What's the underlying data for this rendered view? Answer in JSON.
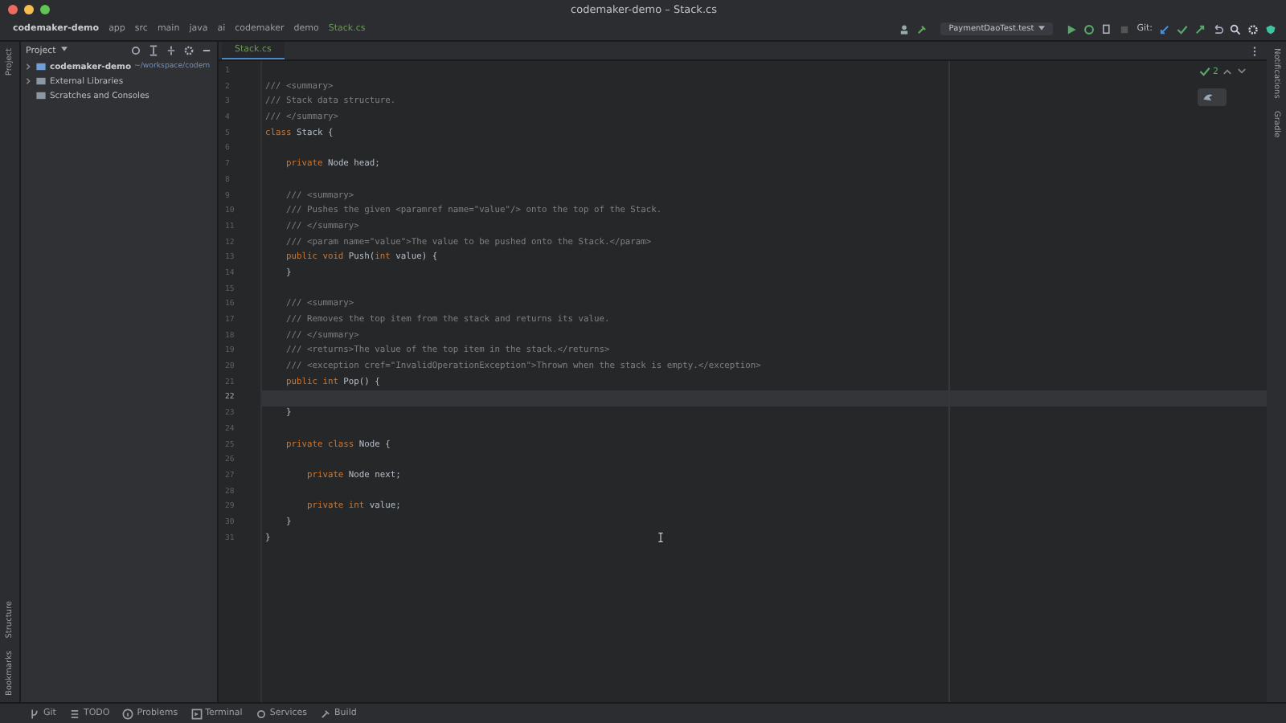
{
  "window": {
    "title": "codemaker-demo – Stack.cs"
  },
  "breadcrumbs": [
    {
      "label": "codemaker-demo",
      "kind": "project"
    },
    {
      "label": "app",
      "kind": "folder"
    },
    {
      "label": "src",
      "kind": "folder"
    },
    {
      "label": "main",
      "kind": "folder"
    },
    {
      "label": "java",
      "kind": "folder"
    },
    {
      "label": "ai",
      "kind": "folder"
    },
    {
      "label": "codemaker",
      "kind": "folder"
    },
    {
      "label": "demo",
      "kind": "folder"
    },
    {
      "label": "Stack.cs",
      "kind": "file"
    }
  ],
  "toolbar": {
    "run_config": "PaymentDaoTest.test",
    "git_label": "Git:"
  },
  "left_strip": [
    "Project",
    "Structure",
    "Bookmarks"
  ],
  "right_strip": [
    "Notifications",
    "Gradle"
  ],
  "project_panel": {
    "title": "Project",
    "tree": [
      {
        "label": "codemaker-demo",
        "path": "~/workspace/codem",
        "expanded": false,
        "kind": "module"
      },
      {
        "label": "External Libraries",
        "expanded": false,
        "kind": "library"
      },
      {
        "label": "Scratches and Consoles",
        "kind": "scratch"
      }
    ]
  },
  "editor_tabs": [
    {
      "label": "Stack.cs",
      "selected": true
    }
  ],
  "inspection": {
    "count": "2"
  },
  "code": [
    {
      "number": "1",
      "current": false
    },
    {
      "number": "2",
      "current": false,
      "tokens": [
        {
          "text": "/// <summary>",
          "kind": "comment"
        }
      ]
    },
    {
      "number": "3",
      "current": false,
      "tokens": [
        {
          "text": "/// Stack data structure.",
          "kind": "comment"
        }
      ]
    },
    {
      "number": "4",
      "current": false,
      "tokens": [
        {
          "text": "/// </summary>",
          "kind": "comment"
        }
      ]
    },
    {
      "number": "5",
      "current": false,
      "tokens": [
        {
          "text": "class",
          "kind": "keyword"
        },
        {
          "text": " Stack {",
          "kind": "plain"
        }
      ]
    },
    {
      "number": "6",
      "current": false
    },
    {
      "number": "7",
      "current": false,
      "tokens": [
        {
          "text": "    private",
          "kind": "keyword"
        },
        {
          "text": " Node head;",
          "kind": "plain"
        }
      ]
    },
    {
      "number": "8",
      "current": false
    },
    {
      "number": "9",
      "current": false,
      "tokens": [
        {
          "text": "    /// <summary>",
          "kind": "comment"
        }
      ]
    },
    {
      "number": "10",
      "current": false,
      "tokens": [
        {
          "text": "    /// Pushes the given <paramref name=\"value\"/> onto the top of the Stack.",
          "kind": "comment"
        }
      ]
    },
    {
      "number": "11",
      "current": false,
      "tokens": [
        {
          "text": "    /// </summary>",
          "kind": "comment"
        }
      ]
    },
    {
      "number": "12",
      "current": false,
      "tokens": [
        {
          "text": "    /// <param name=\"value\">The value to be pushed onto the Stack.</param>",
          "kind": "comment"
        }
      ]
    },
    {
      "number": "13",
      "current": false,
      "tokens": [
        {
          "text": "    public void",
          "kind": "keyword"
        },
        {
          "text": " Push(",
          "kind": "plain"
        },
        {
          "text": "int",
          "kind": "keyword"
        },
        {
          "text": " value) {",
          "kind": "plain"
        }
      ]
    },
    {
      "number": "14",
      "current": false,
      "tokens": [
        {
          "text": "    }",
          "kind": "plain"
        }
      ]
    },
    {
      "number": "15",
      "current": false
    },
    {
      "number": "16",
      "current": false,
      "tokens": [
        {
          "text": "    /// <summary>",
          "kind": "comment"
        }
      ]
    },
    {
      "number": "17",
      "current": false,
      "tokens": [
        {
          "text": "    /// Removes the top item from the stack and returns its value.",
          "kind": "comment"
        }
      ]
    },
    {
      "number": "18",
      "current": false,
      "tokens": [
        {
          "text": "    /// </summary>",
          "kind": "comment"
        }
      ]
    },
    {
      "number": "19",
      "current": false,
      "tokens": [
        {
          "text": "    /// <returns>The value of the top item in the stack.</returns>",
          "kind": "comment"
        }
      ]
    },
    {
      "number": "20",
      "current": false,
      "tokens": [
        {
          "text": "    /// <exception cref=\"InvalidOperationException\">Thrown when the stack is empty.</exception>",
          "kind": "comment"
        }
      ]
    },
    {
      "number": "21",
      "current": false,
      "tokens": [
        {
          "text": "    public int",
          "kind": "keyword"
        },
        {
          "text": " Pop() {",
          "kind": "plain"
        }
      ]
    },
    {
      "number": "22",
      "current": true
    },
    {
      "number": "23",
      "current": false,
      "tokens": [
        {
          "text": "    }",
          "kind": "plain"
        }
      ]
    },
    {
      "number": "24",
      "current": false
    },
    {
      "number": "25",
      "current": false,
      "tokens": [
        {
          "text": "    private class",
          "kind": "keyword"
        },
        {
          "text": " Node {",
          "kind": "plain"
        }
      ]
    },
    {
      "number": "26",
      "current": false
    },
    {
      "number": "27",
      "current": false,
      "tokens": [
        {
          "text": "        private",
          "kind": "keyword"
        },
        {
          "text": " Node next;",
          "kind": "plain"
        }
      ]
    },
    {
      "number": "28",
      "current": false
    },
    {
      "number": "29",
      "current": false,
      "tokens": [
        {
          "text": "        private int",
          "kind": "keyword"
        },
        {
          "text": " value;",
          "kind": "plain"
        }
      ]
    },
    {
      "number": "30",
      "current": false,
      "tokens": [
        {
          "text": "    }",
          "kind": "plain"
        }
      ]
    },
    {
      "number": "31",
      "current": false,
      "tokens": [
        {
          "text": "}",
          "kind": "plain"
        }
      ]
    }
  ],
  "status_tools": [
    {
      "label": "Git",
      "kind": "git"
    },
    {
      "label": "TODO",
      "kind": "todo"
    },
    {
      "label": "Problems",
      "kind": "problems"
    },
    {
      "label": "Terminal",
      "kind": "terminal"
    },
    {
      "label": "Services",
      "kind": "services"
    },
    {
      "label": "Build",
      "kind": "build"
    }
  ]
}
